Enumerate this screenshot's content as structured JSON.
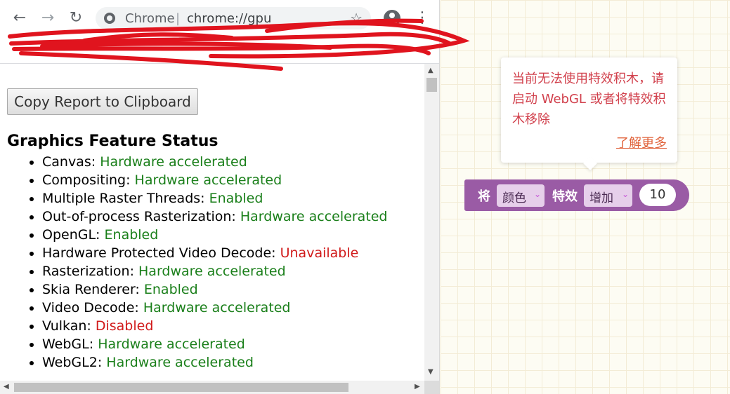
{
  "browser": {
    "omnibox_label": "Chrome",
    "omnibox_separator": "|",
    "url": "chrome://gpu",
    "back_icon": "←",
    "forward_icon": "→",
    "reload_icon": "↻",
    "star_icon": "☆",
    "menu_icon": "⋮"
  },
  "page": {
    "copy_button": "Copy Report to Clipboard",
    "heading": "Graphics Feature Status",
    "features": [
      {
        "name": "Canvas:",
        "status": "Hardware accelerated",
        "state": "ok"
      },
      {
        "name": "Compositing:",
        "status": "Hardware accelerated",
        "state": "ok"
      },
      {
        "name": "Multiple Raster Threads:",
        "status": "Enabled",
        "state": "ok"
      },
      {
        "name": "Out-of-process Rasterization:",
        "status": "Hardware accelerated",
        "state": "ok"
      },
      {
        "name": "OpenGL:",
        "status": "Enabled",
        "state": "ok"
      },
      {
        "name": "Hardware Protected Video Decode:",
        "status": "Unavailable",
        "state": "bad"
      },
      {
        "name": "Rasterization:",
        "status": "Hardware accelerated",
        "state": "ok"
      },
      {
        "name": "Skia Renderer:",
        "status": "Enabled",
        "state": "ok"
      },
      {
        "name": "Video Decode:",
        "status": "Hardware accelerated",
        "state": "ok"
      },
      {
        "name": "Vulkan:",
        "status": "Disabled",
        "state": "bad"
      },
      {
        "name": "WebGL:",
        "status": "Hardware accelerated",
        "state": "ok"
      },
      {
        "name": "WebGL2:",
        "status": "Hardware accelerated",
        "state": "ok"
      }
    ]
  },
  "tooltip": {
    "message": "当前无法使用特效积木，请启动 WebGL 或者将特效积木移除",
    "link": "了解更多"
  },
  "block": {
    "prefix": "将",
    "dropdown1": "颜色",
    "middle": "特效",
    "dropdown2": "增加",
    "value": "10",
    "arrow": "⌄"
  },
  "colors": {
    "ok": "#1a7f1a",
    "bad": "#d11a1a",
    "block": "#9a5ba5",
    "tooltip_text": "#d1404c",
    "scribble": "#e0141e"
  }
}
